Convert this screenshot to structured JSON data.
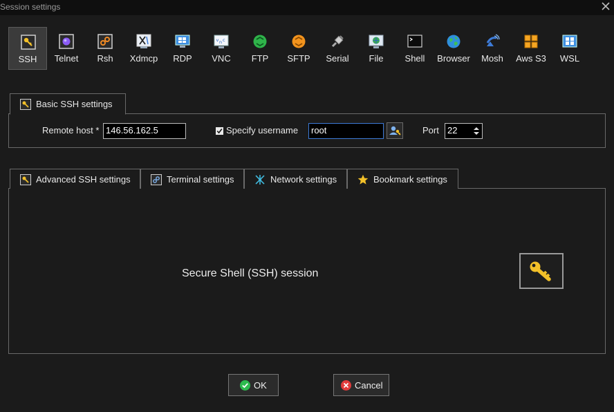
{
  "window": {
    "title": "Session settings"
  },
  "session_types": [
    {
      "label": "SSH",
      "icon": "ssh-icon",
      "active": true
    },
    {
      "label": "Telnet",
      "icon": "telnet-icon"
    },
    {
      "label": "Rsh",
      "icon": "rsh-icon"
    },
    {
      "label": "Xdmcp",
      "icon": "xdmcp-icon"
    },
    {
      "label": "RDP",
      "icon": "rdp-icon"
    },
    {
      "label": "VNC",
      "icon": "vnc-icon"
    },
    {
      "label": "FTP",
      "icon": "ftp-icon"
    },
    {
      "label": "SFTP",
      "icon": "sftp-icon"
    },
    {
      "label": "Serial",
      "icon": "serial-icon"
    },
    {
      "label": "File",
      "icon": "file-icon"
    },
    {
      "label": "Shell",
      "icon": "shell-icon"
    },
    {
      "label": "Browser",
      "icon": "browser-icon"
    },
    {
      "label": "Mosh",
      "icon": "mosh-icon"
    },
    {
      "label": "Aws S3",
      "icon": "aws-s3-icon"
    },
    {
      "label": "WSL",
      "icon": "wsl-icon"
    }
  ],
  "basic": {
    "tab_label": "Basic SSH settings",
    "remote_host_label": "Remote host *",
    "remote_host_value": "146.56.162.5",
    "specify_username_label": "Specify username",
    "specify_username_checked": true,
    "username_value": "root",
    "port_label": "Port",
    "port_value": "22"
  },
  "tabs": [
    {
      "label": "Advanced SSH settings",
      "icon": "wrench-icon"
    },
    {
      "label": "Terminal settings",
      "icon": "terminal-icon"
    },
    {
      "label": "Network settings",
      "icon": "network-icon"
    },
    {
      "label": "Bookmark settings",
      "icon": "star-icon"
    }
  ],
  "content": {
    "description": "Secure Shell (SSH) session"
  },
  "buttons": {
    "ok": "OK",
    "cancel": "Cancel"
  },
  "colors": {
    "accent": "#3d7bd8",
    "key": "#f2c029",
    "ok": "#2dbb4e",
    "cancel": "#e23b3b"
  }
}
